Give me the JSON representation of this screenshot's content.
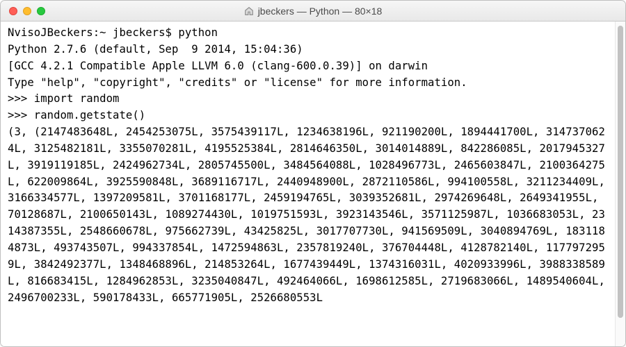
{
  "window": {
    "title": "jbeckers — Python — 80×18"
  },
  "terminal": {
    "text": "NvisoJBeckers:~ jbeckers$ python\nPython 2.7.6 (default, Sep  9 2014, 15:04:36) \n[GCC 4.2.1 Compatible Apple LLVM 6.0 (clang-600.0.39)] on darwin\nType \"help\", \"copyright\", \"credits\" or \"license\" for more information.\n>>> import random\n>>> random.getstate()\n(3, (2147483648L, 2454253075L, 3575439117L, 1234638196L, 921190200L, 1894441700L, 3147370624L, 3125482181L, 3355070281L, 4195525384L, 2814646350L, 3014014889L, 842286085L, 2017945327L, 3919119185L, 2424962734L, 2805745500L, 3484564088L, 1028496773L, 2465603847L, 2100364275L, 622009864L, 3925590848L, 3689116717L, 2440948900L, 2872110586L, 994100558L, 3211234409L, 3166334577L, 1397209581L, 3701168177L, 2459194765L, 3039352681L, 2974269648L, 2649341955L, 70128687L, 2100650143L, 1089274430L, 1019751593L, 3923143546L, 3571125987L, 1036683053L, 2314387355L, 2548660678L, 975662739L, 43425825L, 3017707730L, 941569509L, 3040894769L, 1831184873L, 493743507L, 994337854L, 1472594863L, 2357819240L, 376704448L, 4128782140L, 1177972959L, 3842492377L, 1348468896L, 214853264L, 1677439449L, 1374316031L, 4020933996L, 3988338589L, 816683415L, 1284962853L, 3235040847L, 492464066L, 1698612585L, 2719683066L, 1489540604L, 2496700233L, 590178433L, 665771905L, 2526680553L"
  }
}
